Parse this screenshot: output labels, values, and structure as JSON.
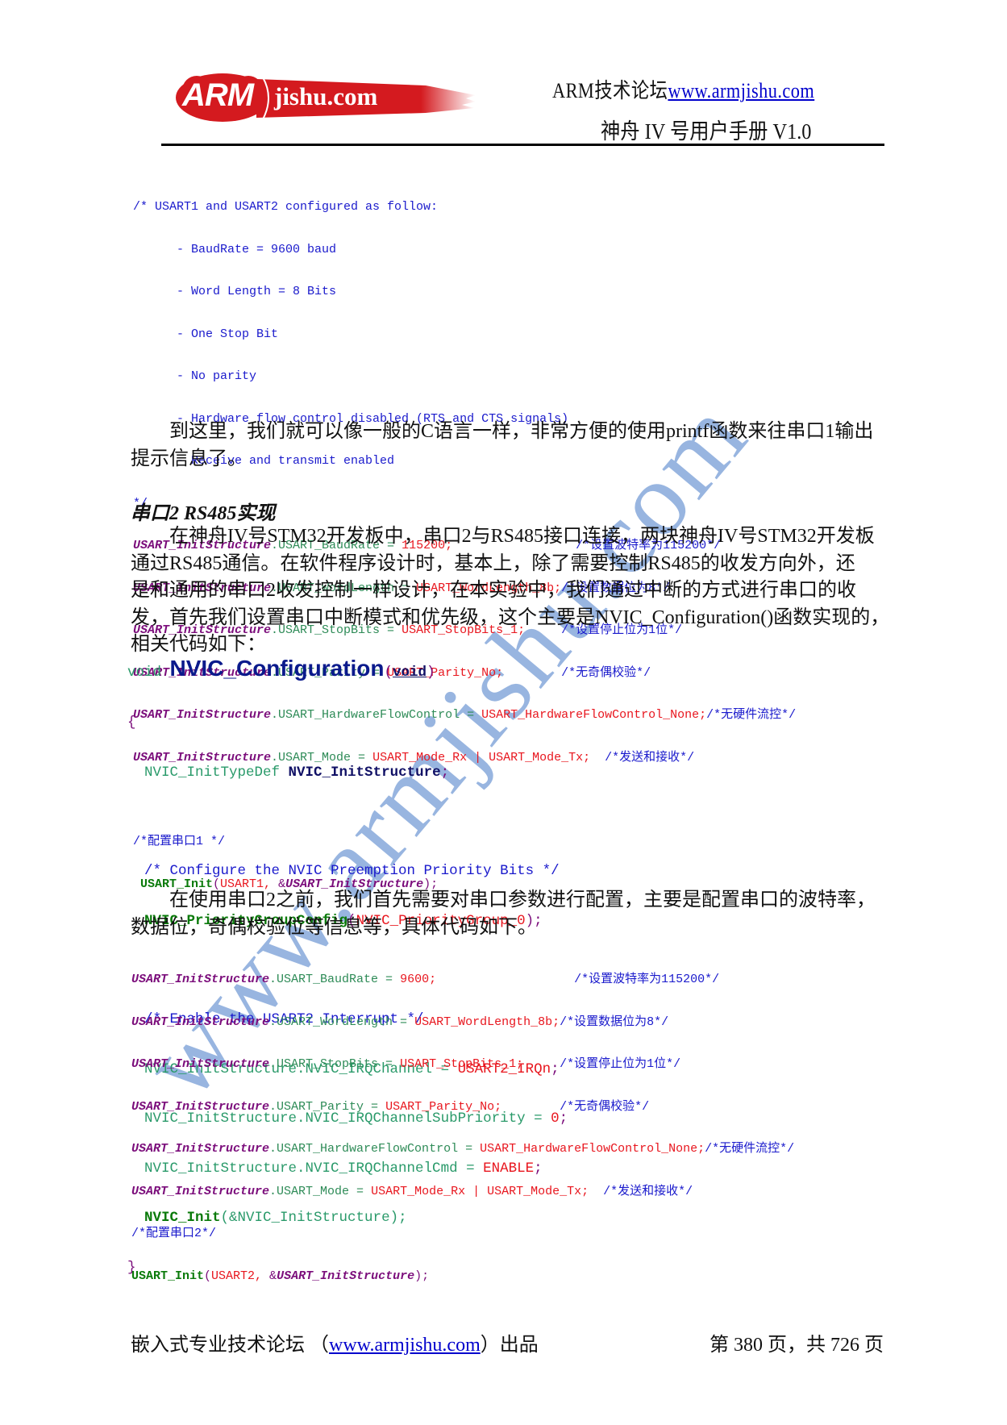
{
  "header": {
    "logo_text_left": "ARM",
    "logo_text_right": "jishu.com",
    "forum_label": "ARM技术论坛",
    "forum_url": "www.armjishu.com",
    "manual_title": "神舟 IV 号用户手册 V1.0"
  },
  "code_block_1": {
    "comment_lines": [
      "/* USART1 and USART2 configured as follow:",
      "      - BaudRate = 9600 baud",
      "      - Word Length = 8 Bits",
      "      - One Stop Bit",
      "      - No parity",
      "      - Hardware flow control disabled (RTS and CTS signals)",
      "      - Receive and transmit enabled",
      "*/"
    ],
    "assignments": [
      {
        "obj": "USART_InitStructure",
        "field": ".USART_BaudRate = ",
        "value": "115200;",
        "pad": "                 ",
        "comment": "/*设置波特率为115200*/"
      },
      {
        "obj": "USART_InitStructure",
        "field": ".USART_WordLength = ",
        "value": "USART_WordLength_8b;",
        "pad": "",
        "comment": "/*设置数据位为8*/"
      },
      {
        "obj": "USART_InitStructure",
        "field": ".USART_StopBits = ",
        "value": "USART_StopBits_1;",
        "pad": "     ",
        "comment": "/*设置停止位为1位*/"
      },
      {
        "obj": "USART_InitStructure",
        "field": ".USART_Parity = ",
        "value": "USART_Parity_No;",
        "pad": "        ",
        "comment": "/*无奇偶校验*/"
      },
      {
        "obj": "USART_InitStructure",
        "field": ".USART_HardwareFlowControl = ",
        "value": "USART_HardwareFlowControl_None;",
        "pad": "",
        "comment": "/*无硬件流控*/"
      },
      {
        "obj": "USART_InitStructure",
        "field": ".USART_Mode = ",
        "value": "USART_Mode_Rx | USART_Mode_Tx;",
        "pad": "  ",
        "comment": "/*发送和接收*/"
      }
    ],
    "config_comment": "/*配置串口1 */",
    "init_call": {
      "fn": " USART_Init",
      "open": "(",
      "arg1": "USART1, ",
      "amp": "&",
      "arg2": "USART_InitStructure",
      "close": ");"
    }
  },
  "paragraph_1": {
    "line1": "到这里，我们就可以像一般的C语言一样，非常方便的使用printf函数来往串口1输出",
    "line2": "提示信息了。"
  },
  "section_heading": "串口2 RS485实现",
  "paragraph_2": {
    "lines": [
      "在神舟IV号STM32开发板中，串口2与RS485接口连接，两块神舟IV号STM32开发板",
      "通过RS485通信。在软件程序设计时，基本上，除了需要控制RS485的收发方向外，还",
      "是和通用的串口2收发控制一样设计，在本实验中，我们通过中断的方式进行串口的收",
      "发，首先我们设置串口中断模式和优先级，这个主要是NVIC_Configuration()函数实现的，",
      "相关代码如下："
    ]
  },
  "code_block_2": {
    "sig_void": "void ",
    "sig_name": "NVIC_Configuration",
    "sig_open": "(",
    "sig_param": "void",
    "sig_close": ")",
    "brace_open": "{",
    "decl_type": "  NVIC_InitTypeDef ",
    "decl_var": "NVIC_InitStructure",
    "decl_end": ";",
    "comment_1": "  /* Configure the NVIC Preemption Priority Bits */",
    "group_fn": "  NVIC_PriorityGroupConfig",
    "group_open": "(",
    "group_arg": "NVIC_PriorityGroup_0",
    "group_close": ");",
    "comment_2": "  /* Enable the USART2 Interrupt */",
    "irq_lines": [
      {
        "field": "  NVIC_InitStructure.NVIC_IRQChannel = ",
        "value": "USART2_IRQn",
        "end": ";"
      },
      {
        "field": "  NVIC_InitStructure.NVIC_IRQChannelSubPriority = ",
        "value": "0",
        "end": ";"
      },
      {
        "field": "  NVIC_InitStructure.NVIC_IRQChannelCmd = ",
        "value": "ENABLE",
        "end": ";"
      }
    ],
    "init_fn": "  NVIC_Init",
    "init_args": "(&NVIC_InitStructure);",
    "brace_close": "}"
  },
  "paragraph_3": {
    "line1": "在使用串口2之前，我们首先需要对串口参数进行配置，主要是配置串口的波特率，",
    "line2": "数据位，奇偶校验位等信息等，具体代码如下。"
  },
  "code_block_3": {
    "assignments": [
      {
        "obj": "USART_InitStructure",
        "field": ".USART_BaudRate = ",
        "value": "9600;",
        "pad": "                   ",
        "comment": "/*设置波特率为115200*/"
      },
      {
        "obj": "USART_InitStructure",
        "field": ".USART_WordLength = ",
        "value": "USART_WordLength_8b;",
        "pad": "",
        "comment": "/*设置数据位为8*/"
      },
      {
        "obj": "USART_InitStructure",
        "field": ".USART_StopBits = ",
        "value": "USART_StopBits_1;",
        "pad": "     ",
        "comment": "/*设置停止位为1位*/"
      },
      {
        "obj": "USART_InitStructure",
        "field": ".USART_Parity = ",
        "value": "USART_Parity_No;",
        "pad": "        ",
        "comment": "/*无奇偶校验*/"
      },
      {
        "obj": "USART_InitStructure",
        "field": ".USART_HardwareFlowControl = ",
        "value": "USART_HardwareFlowControl_None;",
        "pad": "",
        "comment": "/*无硬件流控*/"
      },
      {
        "obj": "USART_InitStructure",
        "field": ".USART_Mode = ",
        "value": "USART_Mode_Rx | USART_Mode_Tx;",
        "pad": "  ",
        "comment": "/*发送和接收*/"
      }
    ],
    "config_comment": "/*配置串口2*/",
    "init_call": {
      "fn": "USART_Init",
      "open": "(",
      "arg1": "USART2, ",
      "amp": "&",
      "arg2": "USART_InitStructure",
      "close": ");"
    }
  },
  "watermark": "www.armjishu.com",
  "footer": {
    "left_prefix": "嵌入式专业技术论坛  （",
    "left_link": "www.armjishu.com",
    "left_suffix": "）出品",
    "page_info": "第 380 页，共 726 页"
  },
  "colors": {
    "logo_red": "#d41a1f",
    "link_blue": "#0000cc",
    "watermark_blue": "#7ea3d8"
  }
}
